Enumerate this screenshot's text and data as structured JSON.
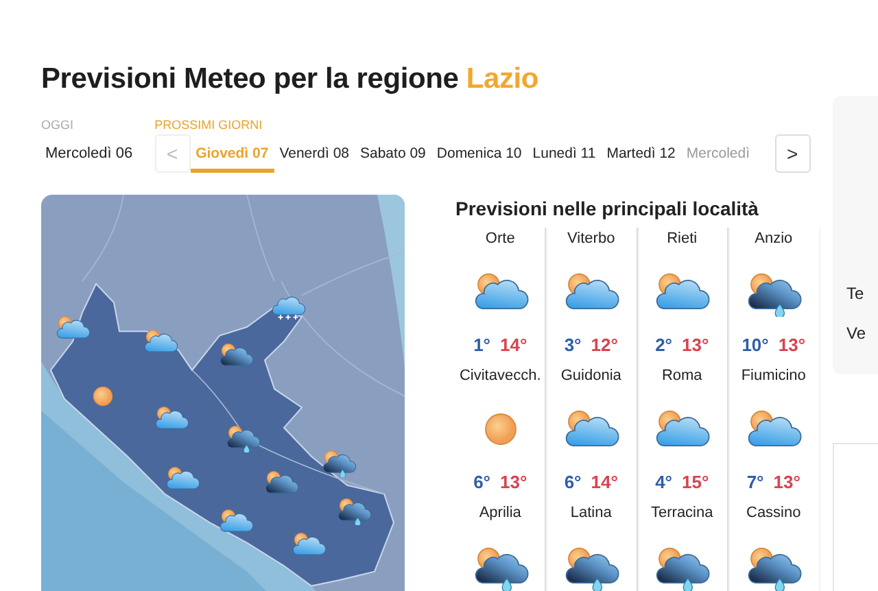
{
  "title": {
    "text": "Previsioni Meteo per la regione",
    "region": "Lazio"
  },
  "today": {
    "label": "OGGI",
    "day": "Mercoledì 06"
  },
  "next_days": {
    "label": "PROSSIMI GIORNI",
    "prev": "<",
    "next": ">",
    "tabs": [
      {
        "label": "Giovedì 07",
        "selected": true
      },
      {
        "label": "Venerdì 08",
        "selected": false
      },
      {
        "label": "Sabato 09",
        "selected": false
      },
      {
        "label": "Domenica 10",
        "selected": false
      },
      {
        "label": "Lunedì 11",
        "selected": false
      },
      {
        "label": "Martedì 12",
        "selected": false
      },
      {
        "label": "Mercoledì",
        "selected": false
      }
    ]
  },
  "map": {
    "kind": "picture",
    "markers": [
      {
        "kind": "partly_cloudy"
      },
      {
        "kind": "partly_cloudy"
      },
      {
        "kind": "mixed"
      },
      {
        "kind": "snow"
      },
      {
        "kind": "sunny"
      },
      {
        "kind": "partly_cloudy"
      },
      {
        "kind": "rain"
      },
      {
        "kind": "rain"
      },
      {
        "kind": "mixed"
      },
      {
        "kind": "partly_cloudy"
      },
      {
        "kind": "rain"
      },
      {
        "kind": "partly_cloudy"
      },
      {
        "kind": "partly_cloudy"
      }
    ]
  },
  "localities": {
    "title": "Previsioni nelle principali località",
    "cities": [
      {
        "name": "Orte",
        "kind": "partly_cloudy",
        "min": "1°",
        "max": "14°"
      },
      {
        "name": "Viterbo",
        "kind": "partly_cloudy",
        "min": "3°",
        "max": "12°"
      },
      {
        "name": "Rieti",
        "kind": "partly_cloudy",
        "min": "2°",
        "max": "13°"
      },
      {
        "name": "Anzio",
        "kind": "rain",
        "min": "10°",
        "max": "13°"
      },
      {
        "name": "Civitavecch.",
        "kind": "sunny",
        "min": "6°",
        "max": "13°"
      },
      {
        "name": "Guidonia",
        "kind": "partly_cloudy",
        "min": "6°",
        "max": "14°"
      },
      {
        "name": "Roma",
        "kind": "partly_cloudy",
        "min": "4°",
        "max": "15°"
      },
      {
        "name": "Fiumicino",
        "kind": "partly_cloudy",
        "min": "7°",
        "max": "13°"
      },
      {
        "name": "Aprilia",
        "kind": "rain"
      },
      {
        "name": "Latina",
        "kind": "rain"
      },
      {
        "name": "Terracina",
        "kind": "rain"
      },
      {
        "name": "Cassino",
        "kind": "rain"
      }
    ]
  },
  "side_panel": {
    "lines": [
      "Te",
      "Ve"
    ]
  }
}
